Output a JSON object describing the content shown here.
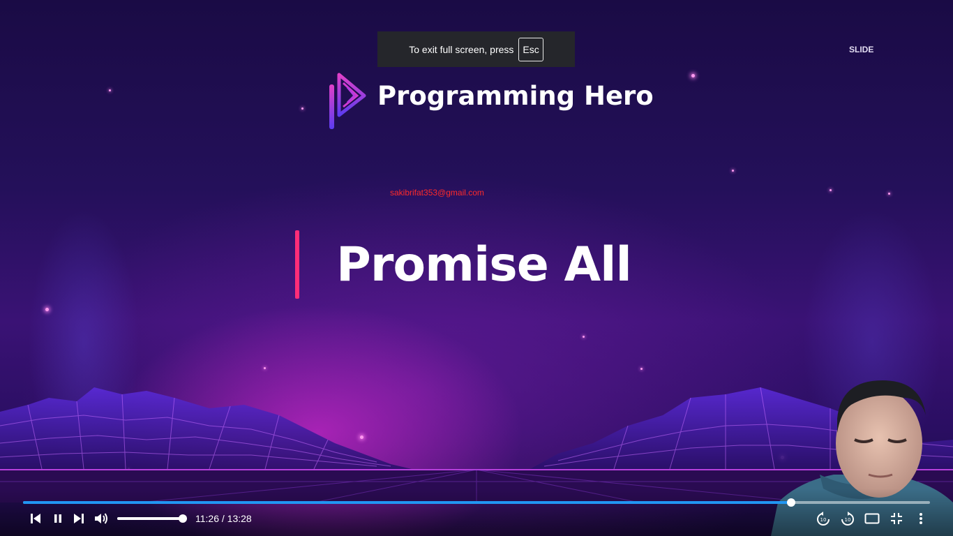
{
  "banner": {
    "text": "To exit full screen, press",
    "key": "Esc"
  },
  "slide": {
    "label": "SLIDE",
    "brand": "Programming Hero",
    "watermark_email": "sakibrifat353@gmail.com",
    "title": "Promise All"
  },
  "player": {
    "current_time": "11:26",
    "separator": " / ",
    "duration": "13:28",
    "progress_fraction": 0.8472,
    "volume_fraction": 1.0,
    "buttons": {
      "previous": "skip-previous-icon",
      "pause": "pause-icon",
      "next": "skip-next-icon",
      "volume": "volume-icon",
      "rewind": "rewind-10-icon",
      "forward": "forward-10-icon",
      "theater": "theater-mode-icon",
      "exit_fullscreen": "exit-fullscreen-icon",
      "more": "more-options-icon"
    }
  },
  "colors": {
    "progress": "#2196f3",
    "accent_bar": "#ff2d78",
    "email": "#ff2a2a",
    "banner_bg": "#25262b"
  }
}
